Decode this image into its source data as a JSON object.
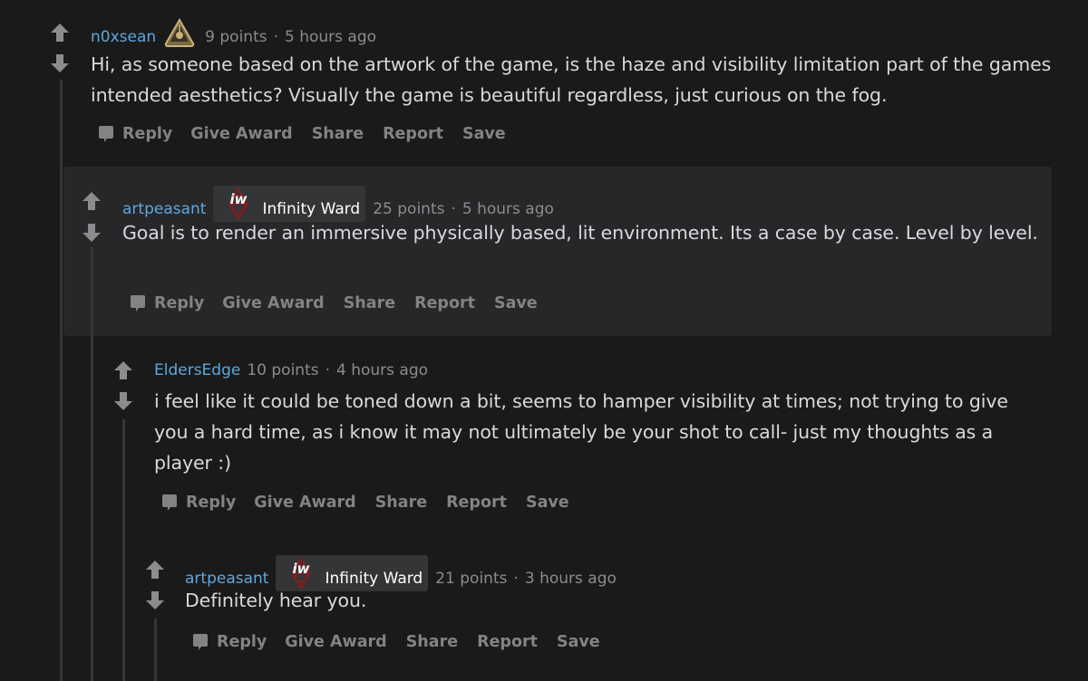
{
  "colors": {
    "background": "#1a1a1b",
    "highlight_panel": "#272729",
    "author": "#5ea8dd",
    "meta": "#8a8c8e",
    "actions": "#818384",
    "body_text": "#d7dadc",
    "flair_bg": "#343536"
  },
  "icons": {
    "upvote": "arrow-up-icon",
    "downvote": "arrow-down-icon",
    "reply": "speech-bubble-icon",
    "award": "gold-award-icon",
    "flair": "infinity-ward-logo-icon"
  },
  "comments": [
    {
      "author": "n0xsean",
      "has_award": true,
      "points": "9 points",
      "separator": "·",
      "time": "5 hours ago",
      "body": "Hi, as someone based on the artwork of the game, is the haze and visibility limitation part of the games intended aesthetics? Visually the game is beautiful regardless, just curious on the fog.",
      "actions": [
        "Reply",
        "Give Award",
        "Share",
        "Report",
        "Save"
      ]
    },
    {
      "author": "artpeasant",
      "flair": "Infinity Ward",
      "flair_logo_text": "iw",
      "points": "25 points",
      "separator": "·",
      "time": "5 hours ago",
      "body": "Goal is to render an immersive physically based, lit environment. Its a case by case. Level by level.",
      "actions": [
        "Reply",
        "Give Award",
        "Share",
        "Report",
        "Save"
      ]
    },
    {
      "author": "EldersEdge",
      "points": "10 points",
      "separator": "·",
      "time": "4 hours ago",
      "body": "i feel like it could be toned down a bit, seems to hamper visibility at times; not trying to give you a hard time, as i know it may not ultimately be your shot to call- just my thoughts as a player :)",
      "actions": [
        "Reply",
        "Give Award",
        "Share",
        "Report",
        "Save"
      ]
    },
    {
      "author": "artpeasant",
      "flair": "Infinity Ward",
      "flair_logo_text": "iw",
      "points": "21 points",
      "separator": "·",
      "time": "3 hours ago",
      "body": "Definitely hear you.",
      "actions": [
        "Reply",
        "Give Award",
        "Share",
        "Report",
        "Save"
      ]
    }
  ]
}
